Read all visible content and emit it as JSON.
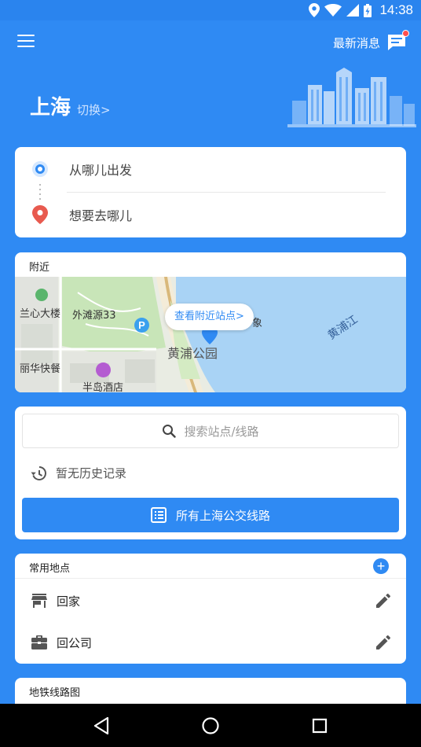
{
  "status_bar": {
    "time": "14:38"
  },
  "header": {
    "news_label": "最新消息",
    "city_name": "上海",
    "city_switch": "切换>"
  },
  "route": {
    "origin_placeholder": "从哪儿出发",
    "destination_placeholder": "想要去哪儿"
  },
  "nearby": {
    "title": "附近",
    "find_stations_label": "查看附近站点>",
    "map_labels": {
      "lanxin": "兰心大楼",
      "waitanyuan": "外滩源33",
      "huangpu_park": "黄浦公园",
      "huangpu_river": "黄浦江",
      "lihua": "丽华快餐",
      "peninsula": "半岛酒店",
      "partial": "象"
    }
  },
  "search": {
    "placeholder": "搜索站点/线路",
    "history_empty": "暂无历史记录",
    "all_lines_button": "所有上海公交线路"
  },
  "frequent_places": {
    "title": "常用地点",
    "add_icon": "+",
    "items": [
      {
        "label": "回家",
        "icon": "store-icon"
      },
      {
        "label": "回公司",
        "icon": "briefcase-icon"
      }
    ]
  },
  "metro": {
    "title": "地铁线路图"
  },
  "colors": {
    "primary": "#2f8af3",
    "destination_pin": "#e85a4f",
    "notification_dot": "#ff4e4e"
  }
}
